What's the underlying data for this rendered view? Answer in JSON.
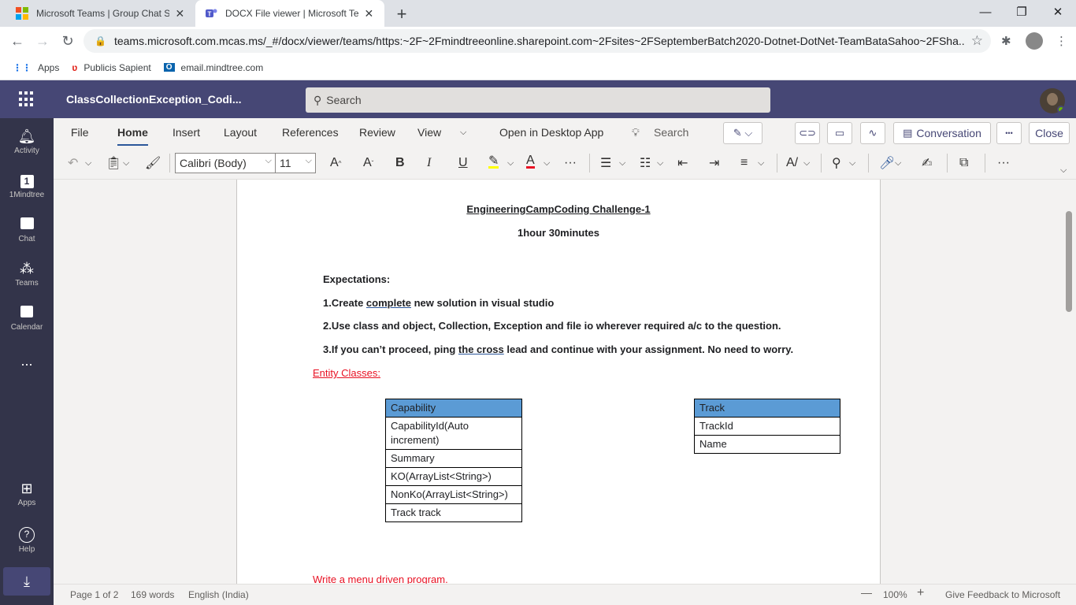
{
  "browser": {
    "tabs": [
      {
        "title": "Microsoft Teams | Group Chat So",
        "active": false
      },
      {
        "title": "DOCX File viewer | Microsoft Tea",
        "active": true
      }
    ],
    "url": "teams.microsoft.com.mcas.ms/_#/docx/viewer/teams/https:~2F~2Fmindtreeonline.sharepoint.com~2Fsites~2FSeptemberBatch2020-Dotnet-DotNet-TeamBataSahoo~2FSha...",
    "bookmarks": [
      {
        "label": "Apps",
        "icon": "apps-grid-icon"
      },
      {
        "label": "Publicis Sapient",
        "icon": "publicis-icon"
      },
      {
        "label": "email.mindtree.com",
        "icon": "outlook-icon"
      }
    ]
  },
  "teams": {
    "doc_title": "ClassCollectionException_Codi...",
    "search_placeholder": "Search",
    "rail": [
      {
        "label": "Activity",
        "icon": "bell-icon"
      },
      {
        "label": "1Mindtree",
        "icon": "app-1-icon"
      },
      {
        "label": "Chat",
        "icon": "chat-icon"
      },
      {
        "label": "Teams",
        "icon": "teams-icon"
      },
      {
        "label": "Calendar",
        "icon": "calendar-icon"
      },
      {
        "label": "...",
        "icon": "more-icon"
      },
      {
        "label": "Apps",
        "icon": "apps-icon"
      },
      {
        "label": "Help",
        "icon": "help-icon"
      }
    ]
  },
  "ribbon": {
    "tabs": [
      "File",
      "Home",
      "Insert",
      "Layout",
      "References",
      "Review",
      "View"
    ],
    "open_desktop": "Open in Desktop App",
    "search": "Search",
    "conversation": "Conversation",
    "close": "Close",
    "more": "•••",
    "font_name": "Calibri (Body)",
    "font_size": "11"
  },
  "document": {
    "title": "EngineeringCampCoding Challenge-1",
    "duration": "1hour 30minutes",
    "expectations_heading": "Expectations:",
    "item1_a": "1.Create ",
    "item1_b": "complete",
    "item1_c": " new solution in visual studio",
    "item2": "2.Use class and object, Collection, Exception and file io wherever required a/c to the question.",
    "item3_a": "3.If you can’t proceed, ping ",
    "item3_b": "the  cross",
    "item3_c": " lead and continue with your assignment. No need to worry.",
    "entity_heading": "Entity Classes:",
    "capability_table": {
      "header": "Capability",
      "rows": [
        "CapabilityId(Auto increment)",
        "Summary",
        "KO(ArrayList<String>)",
        "NonKo(ArrayList<String>)",
        "Track track"
      ]
    },
    "track_table": {
      "header": "Track",
      "rows": [
        "TrackId",
        "Name"
      ]
    },
    "menu_text": "Write a menu driven program."
  },
  "status": {
    "page": "Page 1 of 2",
    "words": "169 words",
    "language": "English (India)",
    "zoom": "100%",
    "feedback": "Give Feedback to Microsoft"
  }
}
